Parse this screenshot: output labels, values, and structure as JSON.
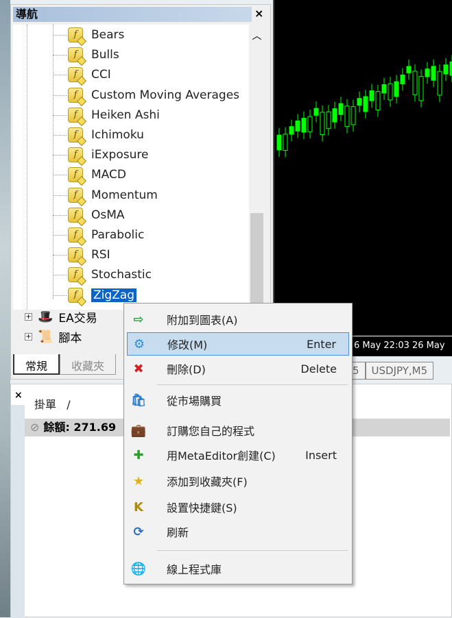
{
  "navigator": {
    "title": "導航",
    "close": "×",
    "indicators": [
      "Bears",
      "Bulls",
      "CCI",
      "Custom Moving Averages",
      "Heiken Ashi",
      "Ichimoku",
      "iExposure",
      "MACD",
      "Momentum",
      "OsMA",
      "Parabolic",
      "RSI",
      "Stochastic",
      "ZigZag"
    ],
    "selected": "ZigZag",
    "folders": [
      {
        "label": "EA交易",
        "expand": "+",
        "icon": "expert-icon"
      },
      {
        "label": "腳本",
        "expand": "+",
        "icon": "script-icon"
      }
    ],
    "tabs": [
      {
        "label": "常規",
        "active": true
      },
      {
        "label": "收藏夾",
        "active": false
      }
    ]
  },
  "chart": {
    "time_label": "6 May 22:03   26 May",
    "tabs": [
      "5",
      "USDJPY,M5"
    ],
    "candle_color": "#00ff00"
  },
  "terminal": {
    "close": "×",
    "header": "掛單   /",
    "balance": "餘額: 271.69"
  },
  "context_menu": {
    "items": [
      {
        "label": "附加到圖表(A)",
        "shortcut": "",
        "icon": "attach-chart-icon",
        "glyph": "⇨",
        "color": "#2a9a3a"
      },
      {
        "label": "修改(M)",
        "shortcut": "Enter",
        "icon": "gear-icon",
        "glyph": "⚙",
        "color": "#2a8fd0",
        "highlighted": true
      },
      {
        "label": "刪除(D)",
        "shortcut": "Delete",
        "icon": "delete-icon",
        "glyph": "✖",
        "color": "#d42020"
      },
      {
        "label": "從市場購買",
        "shortcut": "",
        "icon": "market-bag-icon",
        "glyph": "🛍",
        "color": "#2a7fd0"
      },
      {
        "label": "訂購您自己的程式",
        "shortcut": "",
        "icon": "briefcase-icon",
        "glyph": "💼",
        "color": "#8a5a30"
      },
      {
        "label": "用MetaEditor創建(C)",
        "shortcut": "Insert",
        "icon": "plus-icon",
        "glyph": "✚",
        "color": "#2aa02a"
      },
      {
        "label": "添加到收藏夾(F)",
        "shortcut": "",
        "icon": "star-icon",
        "glyph": "★",
        "color": "#e0b020"
      },
      {
        "label": "設置快捷鍵(S)",
        "shortcut": "",
        "icon": "hotkey-icon",
        "glyph": "K",
        "color": "#b08a00"
      },
      {
        "label": "刷新",
        "shortcut": "",
        "icon": "refresh-icon",
        "glyph": "⟳",
        "color": "#2a70c0"
      },
      {
        "label": "線上程式庫",
        "shortcut": "",
        "icon": "globe-icon",
        "glyph": "🌐",
        "color": "#2a90c0"
      }
    ]
  }
}
